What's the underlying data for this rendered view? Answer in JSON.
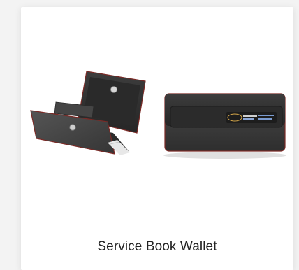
{
  "product": {
    "title": "Service Book Wallet",
    "image_alt": "Service Book Wallet"
  },
  "colors": {
    "page_background": "#f3f3f3",
    "card_background": "#ffffff",
    "title_text": "#222222",
    "wallet_body": "#3a3a3a",
    "wallet_stitch": "#8a2d2a"
  },
  "icons": {
    "open_wallet": "open-wallet-photo",
    "closed_wallet": "closed-wallet-photo"
  }
}
